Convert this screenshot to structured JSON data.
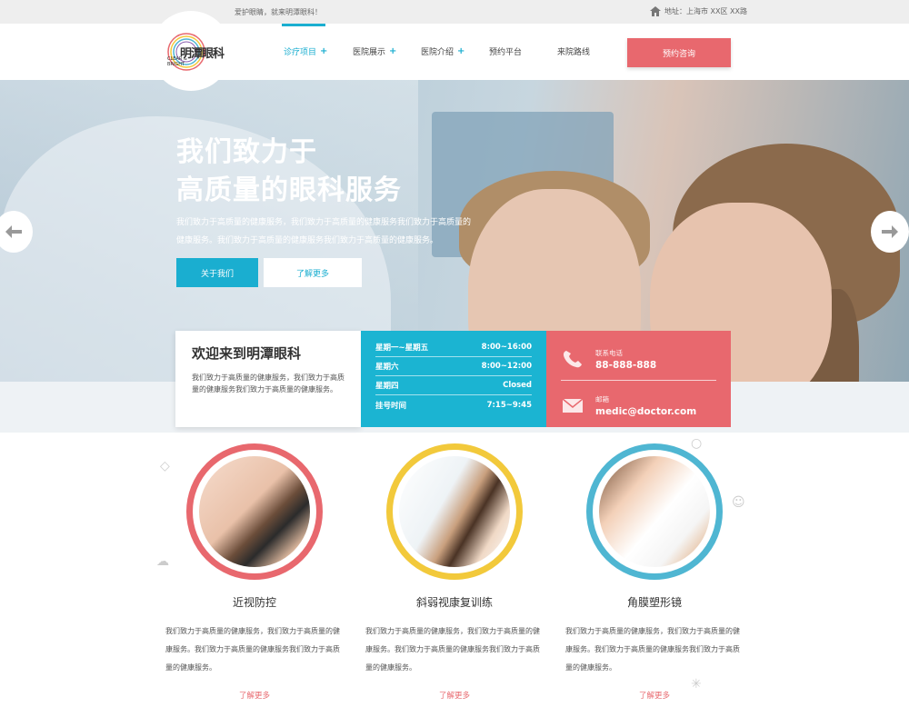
{
  "topbar": {
    "slogan": "爱护眼睛，就来明潭眼科！",
    "address": "地址：上海市 XX区 XX路"
  },
  "logo": {
    "text": "明潭眼科",
    "en_line1": "CLEAR &",
    "en_line2": "BRIGHT"
  },
  "nav": {
    "items": [
      {
        "label": "诊疗项目",
        "plus": "+",
        "active": true
      },
      {
        "label": "医院展示",
        "plus": "+"
      },
      {
        "label": "医院介绍",
        "plus": "+"
      },
      {
        "label": "预约平台",
        "plus": ""
      },
      {
        "label": "来院路线",
        "plus": ""
      }
    ],
    "consult_button": "预约咨询"
  },
  "hero": {
    "title_line1": "我们致力于",
    "title_line2": "高质量的眼科服务",
    "description": "我们致力于高质量的健康服务，我们致力于高质量的健康服务我们致力于高质量的健康服务。我们致力于高质量的健康服务我们致力于高质量的健康服务。",
    "about_button": "关于我们",
    "more_button": "了解更多"
  },
  "welcome": {
    "title": "欢迎来到明潭眼科",
    "text": "我们致力于高质量的健康服务，我们致力于高质量的健康服务我们致力于高质量的健康服务。"
  },
  "hours": [
    {
      "day": "星期一~星期五",
      "time": "8:00~16:00"
    },
    {
      "day": "星期六",
      "time": "8:00~12:00"
    },
    {
      "day": "星期四",
      "time": "Closed"
    },
    {
      "day": "挂号时间",
      "time": "7:15~9:45"
    }
  ],
  "contact": {
    "phone_label": "联系电话",
    "phone": "88-888-888",
    "email_label": "邮箱",
    "email": "medic@doctor.com"
  },
  "services": [
    {
      "title": "近视防控",
      "text": "我们致力于高质量的健康服务，我们致力于高质量的健康服务。我们致力于高质量的健康服务我们致力于高质量的健康服务。",
      "more": "了解更多",
      "ring_color": "#e8686e"
    },
    {
      "title": "斜弱视康复训练",
      "text": "我们致力于高质量的健康服务，我们致力于高质量的健康服务。我们致力于高质量的健康服务我们致力于高质量的健康服务。",
      "more": "了解更多",
      "ring_color": "#f2c93b"
    },
    {
      "title": "角膜塑形镜",
      "text": "我们致力于高质量的健康服务，我们致力于高质量的健康服务。我们致力于高质量的健康服务我们致力于高质量的健康服务。",
      "more": "了解更多",
      "ring_color": "#4fb6d2"
    }
  ],
  "colors": {
    "accent_blue": "#1aaed0",
    "accent_red": "#e8686e"
  }
}
